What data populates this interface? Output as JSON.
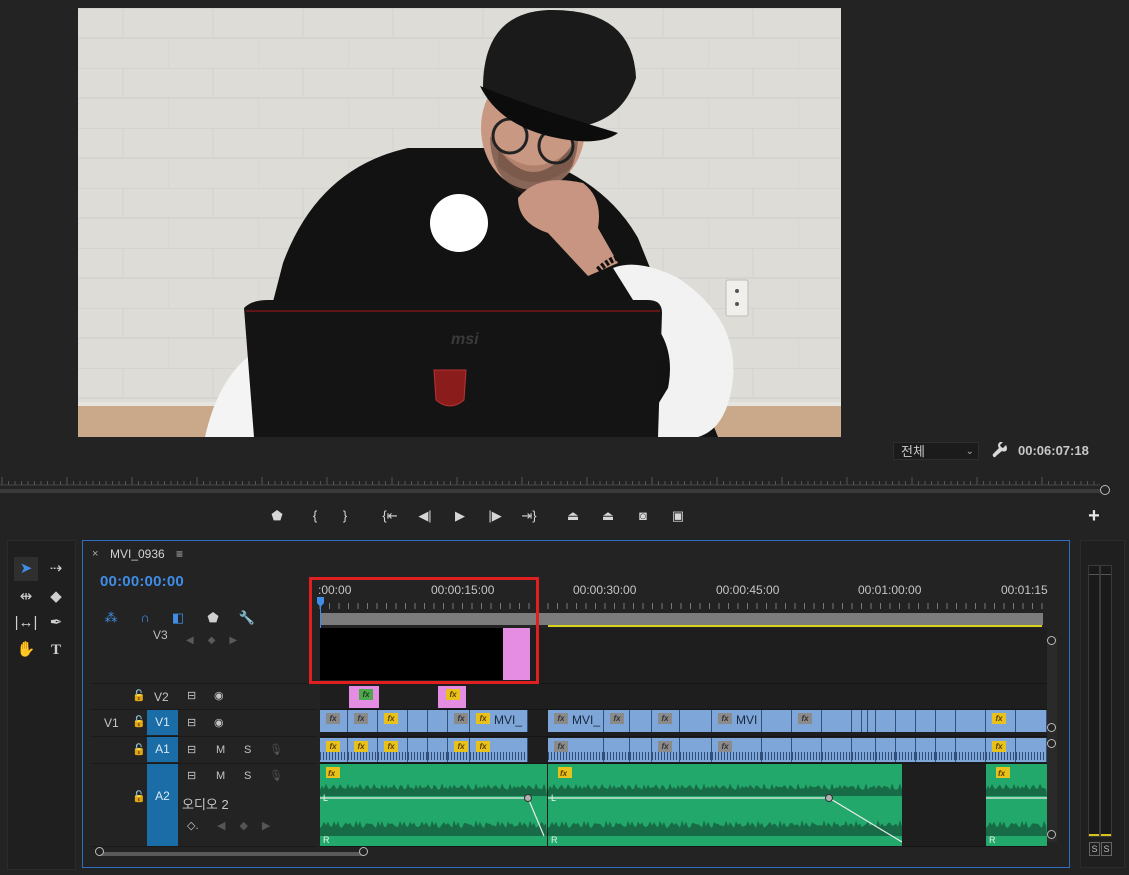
{
  "program_monitor": {
    "zoom": "전체",
    "duration": "00:06:07:18",
    "transport_icons": [
      "marker-icon",
      "mark-in-icon",
      "mark-out-icon",
      "go-to-in-icon",
      "step-back-icon",
      "play-icon",
      "step-forward-icon",
      "go-to-out-icon",
      "lift-icon",
      "extract-icon",
      "export-frame-icon",
      "comparison-view-icon"
    ],
    "add_label": "+"
  },
  "timeline": {
    "sequence_tab": "MVI_0936",
    "tab_close": "×",
    "tab_menu": "≡",
    "timecode": "00:00:00:00",
    "ruler_labels": [
      ":00:00",
      "00:00:15:00",
      "00:00:30:00",
      "00:00:45:00",
      "00:01:00:00",
      "00:01:15"
    ],
    "tracks": {
      "v3": "V3",
      "v2": "V2",
      "v1_source": "V1",
      "v1": "V1",
      "a1": "A1",
      "a2": "A2",
      "a2_name": "오디오 2",
      "mute": "M",
      "solo": "S"
    },
    "v1_clip_label": "MVI_",
    "v1_clip_label2": "MVI_",
    "v1_clip_label3": "MVI",
    "fx": "fx",
    "audio_channel_l": "L",
    "audio_channel_r": "R"
  },
  "tools": [
    "selection-tool",
    "track-select-tool",
    "ripple-edit-tool",
    "razor-tool",
    "slip-tool",
    "pen-tool",
    "hand-tool",
    "type-tool"
  ],
  "meters": {
    "solo_l": "S",
    "solo_r": "S"
  },
  "colors": {
    "accent": "#3f8de6",
    "video_clip": "#7fa6d9",
    "audio_clip": "#23a86b",
    "highlight": "#e02020",
    "pink_clip": "#e58de2"
  }
}
